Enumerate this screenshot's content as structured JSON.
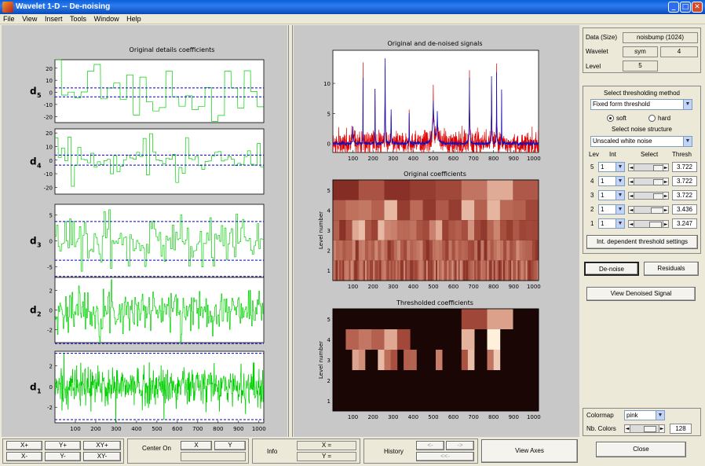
{
  "window": {
    "title": "Wavelet 1-D  --  De-noising",
    "minimize": "_",
    "maximize": "□",
    "close": "✕"
  },
  "menu": [
    "File",
    "View",
    "Insert",
    "Tools",
    "Window",
    "Help"
  ],
  "left_plot": {
    "title": "Original details coefficients",
    "labels": [
      {
        "main": "d",
        "sub": "5",
        "yticks": [
          "20",
          "10",
          "0",
          "-10",
          "-20"
        ]
      },
      {
        "main": "d",
        "sub": "4",
        "yticks": [
          "20",
          "10",
          "0",
          "-10",
          "-20"
        ]
      },
      {
        "main": "d",
        "sub": "3",
        "yticks": [
          "5",
          "0",
          "-5"
        ]
      },
      {
        "main": "d",
        "sub": "2",
        "yticks": [
          "2",
          "0",
          "-2"
        ]
      },
      {
        "main": "d",
        "sub": "1",
        "yticks": [
          "2",
          "0",
          "-2"
        ]
      }
    ],
    "xticks": [
      "100",
      "200",
      "300",
      "400",
      "500",
      "600",
      "700",
      "800",
      "900",
      "1000"
    ]
  },
  "mid_plots": {
    "signal_title": "Original and de-noised signals",
    "signal_yticks": [
      "10",
      "5",
      "0"
    ],
    "orig_coef_title": "Original coefficients",
    "thr_coef_title": "Thresholded coefficients",
    "ylabel": "Level number",
    "level_ticks": [
      "5",
      "4",
      "3",
      "2",
      "1"
    ],
    "xticks": [
      "100",
      "200",
      "300",
      "400",
      "500",
      "600",
      "700",
      "800",
      "900",
      "1000"
    ]
  },
  "info": {
    "data_label": "Data  (Size)",
    "data_value": "noisbump  (1024)",
    "wavelet_label": "Wavelet",
    "wavelet_family": "sym",
    "wavelet_order": "4",
    "level_label": "Level",
    "level_value": "5"
  },
  "thresholding": {
    "method_title": "Select thresholding method",
    "method_value": "Fixed form threshold",
    "soft_label": "soft",
    "hard_label": "hard",
    "noise_title": "Select noise structure",
    "noise_value": "Unscaled white noise",
    "col_lev": "Lev",
    "col_int": "Int",
    "col_select": "Select",
    "col_thresh": "Thresh",
    "rows": [
      {
        "lev": "5",
        "int": "1",
        "thresh": "3.722",
        "pos": 0.15
      },
      {
        "lev": "4",
        "int": "1",
        "thresh": "3.722",
        "pos": 0.15
      },
      {
        "lev": "3",
        "int": "1",
        "thresh": "3.722",
        "pos": 0.15
      },
      {
        "lev": "2",
        "int": "1",
        "thresh": "3.436",
        "pos": 0.13
      },
      {
        "lev": "1",
        "int": "1",
        "thresh": "3.247",
        "pos": 0.12
      }
    ],
    "int_dep_button": "Int. dependent threshold settings"
  },
  "actions": {
    "denoise": "De-noise",
    "residuals": "Residuals",
    "view_denoised": "View Denoised Signal"
  },
  "colormap": {
    "label": "Colormap",
    "value": "pink",
    "nb_label": "Nb. Colors",
    "nb_value": "128"
  },
  "close_button": "Close",
  "bottom": {
    "xplus": "X+",
    "yplus": "Y+",
    "xyplus": "XY+",
    "xminus": "X-",
    "yminus": "Y-",
    "xyminus": "XY-",
    "center_on": "Center On",
    "x": "X",
    "y": "Y",
    "info": "Info",
    "x_eq": "X =",
    "y_eq": "Y =",
    "history": "History",
    "h_left": "<-",
    "h_right": "->",
    "h_back": "<<-",
    "view_axes": "View Axes"
  },
  "colors": {
    "detail_line": "#00D000",
    "threshold_line": "#0000C8",
    "noisy_signal": "#E00000",
    "denoised_signal": "#1010C0",
    "panel_bg": "#C8C8C8"
  }
}
